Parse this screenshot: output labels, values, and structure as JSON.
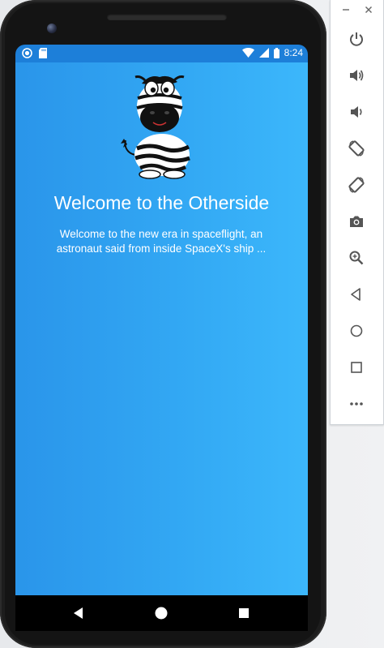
{
  "status_bar": {
    "time": "8:24"
  },
  "app": {
    "title": "Welcome to the Otherside",
    "body": "Welcome to the new era in spaceflight, an astronaut said from inside SpaceX's ship ...",
    "gradient_left": "#2a95ea",
    "gradient_right": "#3cb7fb",
    "status_bar_color": "#1d7fd9"
  },
  "emulator_toolbar": {
    "window_controls": [
      "minimize-icon",
      "close-icon"
    ],
    "buttons": [
      "power-icon",
      "volume-up-icon",
      "volume-down-icon",
      "rotate-left-icon",
      "rotate-right-icon",
      "camera-icon",
      "zoom-icon",
      "back-icon",
      "home-icon",
      "overview-icon",
      "more-icon"
    ]
  },
  "nav_bar": {
    "buttons": [
      "back-icon",
      "home-icon",
      "recents-icon"
    ]
  }
}
